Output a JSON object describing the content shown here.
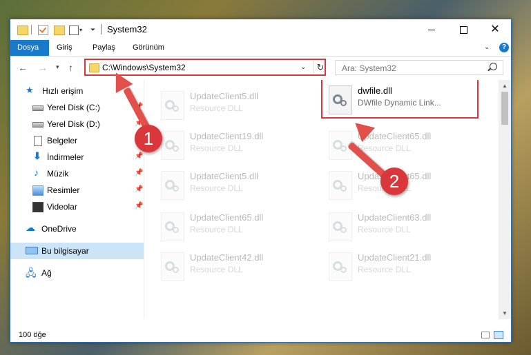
{
  "window": {
    "title": "System32",
    "controls": {
      "minimize": "minimize",
      "maximize": "maximize",
      "close": "✕"
    }
  },
  "ribbon": {
    "tabs": [
      "Dosya",
      "Giriş",
      "Paylaş",
      "Görünüm"
    ]
  },
  "address": {
    "path": "C:\\Windows\\System32",
    "search_placeholder": "Ara: System32"
  },
  "sidebar": {
    "items": [
      {
        "label": "Hızlı erişim",
        "icon": "star-icon"
      },
      {
        "label": "Yerel Disk (C:)",
        "icon": "disk-icon",
        "pinned": true
      },
      {
        "label": "Yerel Disk (D:)",
        "icon": "disk-icon",
        "pinned": true
      },
      {
        "label": "Belgeler",
        "icon": "documents-icon",
        "pinned": true
      },
      {
        "label": "İndirmeler",
        "icon": "downloads-icon",
        "pinned": true
      },
      {
        "label": "Müzik",
        "icon": "music-icon",
        "pinned": true
      },
      {
        "label": "Resimler",
        "icon": "pictures-icon",
        "pinned": true
      },
      {
        "label": "Videolar",
        "icon": "videos-icon",
        "pinned": true
      },
      {
        "label": "OneDrive",
        "icon": "cloud-icon"
      },
      {
        "label": "Bu bilgisayar",
        "icon": "computer-icon",
        "selected": true
      },
      {
        "label": "Ağ",
        "icon": "network-icon"
      }
    ]
  },
  "files": [
    {
      "name": "UpdateClient5.dll",
      "desc": "Resource DLL"
    },
    {
      "name": "dwfile.dll",
      "desc": "DWfile Dynamic Link..."
    },
    {
      "name": "UpdateClient19.dll",
      "desc": "Resource DLL"
    },
    {
      "name": "UpdateClient65.dll",
      "desc": "Resource DLL"
    },
    {
      "name": "UpdateClient5.dll",
      "desc": "Resource DLL"
    },
    {
      "name": "UpdateClient65.dll",
      "desc": "Resource DLL"
    },
    {
      "name": "UpdateClient65.dll",
      "desc": "Resource DLL"
    },
    {
      "name": "UpdateClient63.dll",
      "desc": "Resource DLL"
    },
    {
      "name": "UpdateClient42.dll",
      "desc": "Resource DLL"
    },
    {
      "name": "UpdateClient21.dll",
      "desc": "Resource DLL"
    }
  ],
  "status": {
    "count": "100 öğe"
  },
  "annotations": {
    "step1": "1",
    "step2": "2"
  },
  "colors": {
    "accent": "#1979ca",
    "highlight": "#d9373b"
  }
}
